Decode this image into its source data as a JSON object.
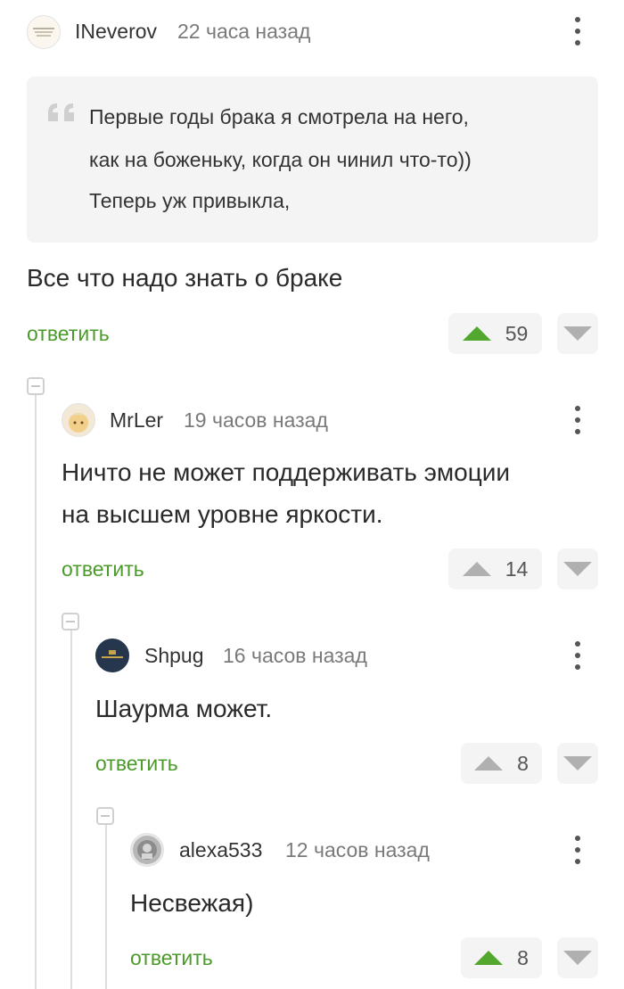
{
  "comments": [
    {
      "username": "INeverov",
      "time": "22 часа назад",
      "quote": [
        "Первые годы брака я смотрела на него,",
        "как на боженьку, когда он чинил что-то))",
        "Теперь уж привыкла,"
      ],
      "text": "Все что надо знать о браке",
      "reply": "ответить",
      "votes": "59",
      "upvoted": true
    },
    {
      "username": "MrLer",
      "time": "19 часов назад",
      "text_lines": [
        "Ничто не может поддерживать эмоции",
        "на высшем уровне яркости."
      ],
      "reply": "ответить",
      "votes": "14",
      "upvoted": false
    },
    {
      "username": "Shpug",
      "time": "16 часов назад",
      "text": "Шаурма может.",
      "reply": "ответить",
      "votes": "8",
      "upvoted": false
    },
    {
      "username": "alexa533",
      "time": "12 часов назад",
      "text": "Несвежая)",
      "reply": "ответить",
      "votes": "8",
      "upvoted": true
    }
  ],
  "colors": {
    "accent_green": "#52a82e",
    "link_green": "#4b9b2a",
    "neutral_gray": "#b0b0b0",
    "box_bg": "#f4f4f4"
  },
  "icons": [
    "kebab-menu-icon",
    "quote-icon",
    "upvote-arrow-icon",
    "downvote-arrow-icon",
    "collapse-thread-icon"
  ]
}
